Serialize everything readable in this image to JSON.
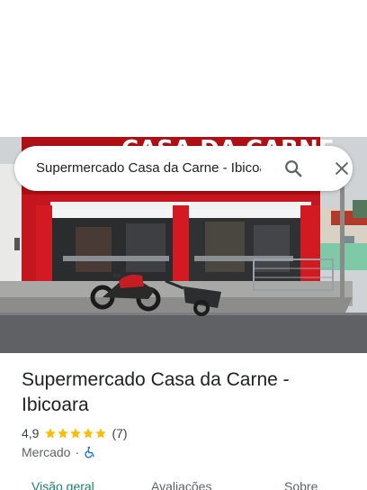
{
  "search": {
    "query": "Supermercado Casa da Carne - Ibicoara"
  },
  "photo": {
    "sign_text": "CASA DA CARNE"
  },
  "place": {
    "title": "Supermercado Casa da Carne - Ibicoara",
    "rating": "4,9",
    "stars": 5,
    "review_count": "(7)",
    "category": "Mercado",
    "separator": "·",
    "accessibility_icon": "wheelchair-icon"
  },
  "tabs": [
    {
      "label": "Visão geral",
      "active": true
    },
    {
      "label": "Avaliações",
      "active": false
    },
    {
      "label": "Sobre",
      "active": false
    }
  ],
  "colors": {
    "star": "#fbbc04",
    "active_tab": "#1a7f72",
    "accessibility_icon": "#1a73e8",
    "storefront_red": "#c4161c"
  }
}
